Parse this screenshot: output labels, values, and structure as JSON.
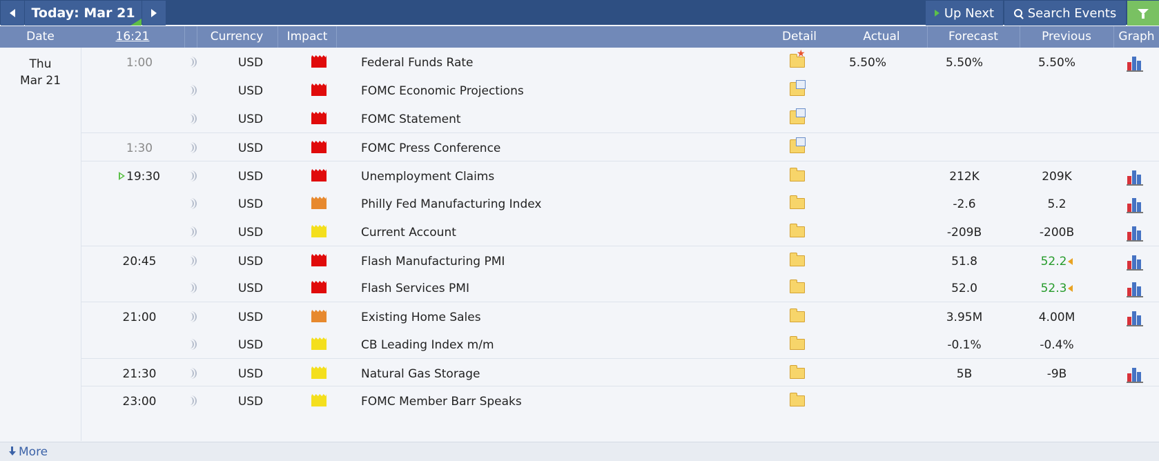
{
  "toolbar": {
    "today_label": "Today: Mar 21",
    "up_next_label": "Up Next",
    "search_label": "Search Events"
  },
  "columns": {
    "date": "Date",
    "time": "16:21",
    "currency": "Currency",
    "impact": "Impact",
    "detail": "Detail",
    "actual": "Actual",
    "forecast": "Forecast",
    "previous": "Previous",
    "graph": "Graph"
  },
  "day": {
    "weekday": "Thu",
    "date": "Mar 21"
  },
  "colors": {
    "high_impact": "#e00b0b",
    "medium_impact": "#e7892e",
    "low_impact": "#f4df1d",
    "better_than_expected": "#269b2b",
    "header_bg": "#7189b8",
    "toolbar_bg": "#2e4f82"
  },
  "events": [
    {
      "time": "1:00",
      "currency": "USD",
      "impact": "high",
      "event": "Federal Funds Rate",
      "actual": "5.50%",
      "forecast": "5.50%",
      "previous": "5.50%",
      "detail_icon": "folder-star-icon",
      "graph": true
    },
    {
      "time": "",
      "currency": "USD",
      "impact": "high",
      "event": "FOMC Economic Projections",
      "actual": "",
      "forecast": "",
      "previous": "",
      "detail_icon": "folder-document-icon",
      "graph": false
    },
    {
      "time": "",
      "currency": "USD",
      "impact": "high",
      "event": "FOMC Statement",
      "actual": "",
      "forecast": "",
      "previous": "",
      "detail_icon": "folder-document-icon",
      "graph": false
    },
    {
      "time": "1:30",
      "currency": "USD",
      "impact": "high",
      "event": "FOMC Press Conference",
      "actual": "",
      "forecast": "",
      "previous": "",
      "detail_icon": "folder-document-icon",
      "graph": false
    },
    {
      "time": "19:30",
      "currency": "USD",
      "impact": "high",
      "event": "Unemployment Claims",
      "actual": "",
      "forecast": "212K",
      "previous": "209K",
      "detail_icon": "folder-icon",
      "graph": true
    },
    {
      "time": "",
      "currency": "USD",
      "impact": "medium",
      "event": "Philly Fed Manufacturing Index",
      "actual": "",
      "forecast": "-2.6",
      "previous": "5.2",
      "detail_icon": "folder-icon",
      "graph": true
    },
    {
      "time": "",
      "currency": "USD",
      "impact": "low",
      "event": "Current Account",
      "actual": "",
      "forecast": "-209B",
      "previous": "-200B",
      "detail_icon": "folder-icon",
      "graph": true
    },
    {
      "time": "20:45",
      "currency": "USD",
      "impact": "high",
      "event": "Flash Manufacturing PMI",
      "actual": "",
      "forecast": "51.8",
      "previous": "52.2",
      "detail_icon": "folder-icon",
      "graph": true
    },
    {
      "time": "",
      "currency": "USD",
      "impact": "high",
      "event": "Flash Services PMI",
      "actual": "",
      "forecast": "52.0",
      "previous": "52.3",
      "detail_icon": "folder-icon",
      "graph": true
    },
    {
      "time": "21:00",
      "currency": "USD",
      "impact": "medium",
      "event": "Existing Home Sales",
      "actual": "",
      "forecast": "3.95M",
      "previous": "4.00M",
      "detail_icon": "folder-icon",
      "graph": true
    },
    {
      "time": "",
      "currency": "USD",
      "impact": "low",
      "event": "CB Leading Index m/m",
      "actual": "",
      "forecast": "-0.1%",
      "previous": "-0.4%",
      "detail_icon": "folder-icon",
      "graph": false
    },
    {
      "time": "21:30",
      "currency": "USD",
      "impact": "low",
      "event": "Natural Gas Storage",
      "actual": "",
      "forecast": "5B",
      "previous": "-9B",
      "detail_icon": "folder-icon",
      "graph": true
    },
    {
      "time": "23:00",
      "currency": "USD",
      "impact": "low",
      "event": "FOMC Member Barr Speaks",
      "actual": "",
      "forecast": "",
      "previous": "",
      "detail_icon": "folder-icon",
      "graph": false
    }
  ],
  "footer": {
    "more_label": "More"
  }
}
